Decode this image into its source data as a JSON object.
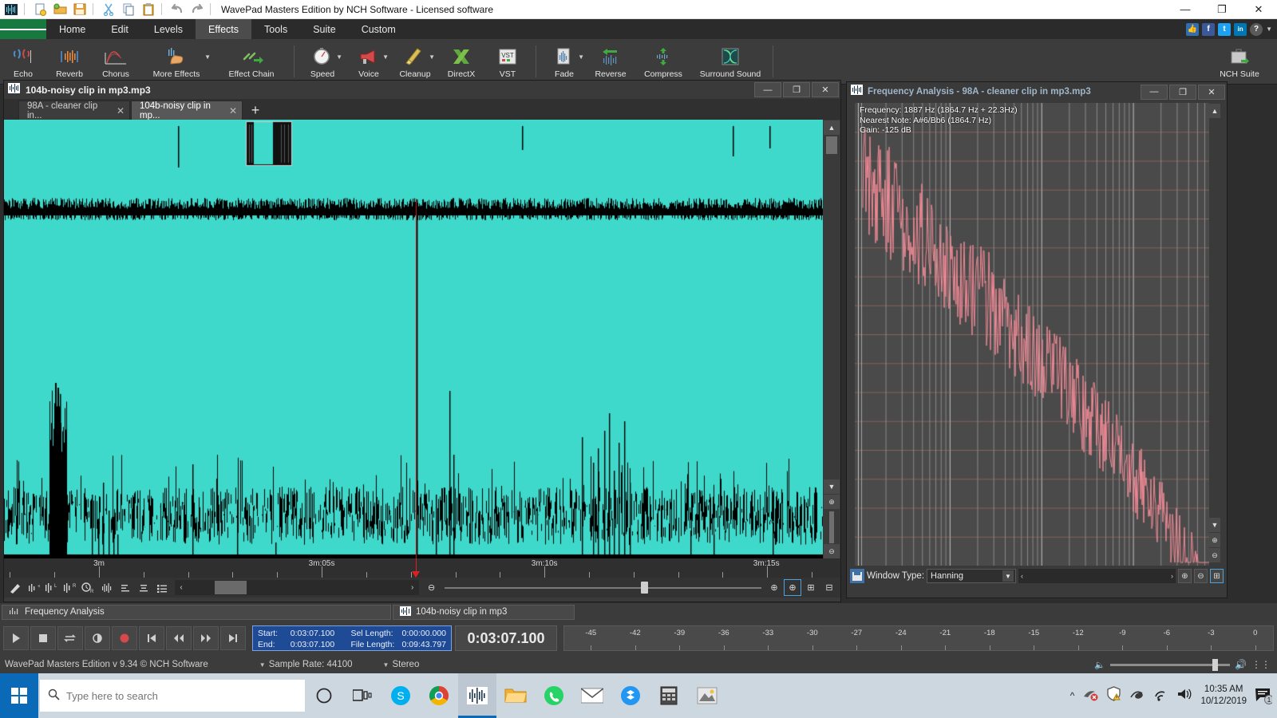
{
  "titlebar": {
    "app_icon": "waveform-icon",
    "title": "WavePad Masters Edition by NCH Software - Licensed software",
    "quick_actions": [
      {
        "name": "new-file-icon",
        "glyph": "📄"
      },
      {
        "name": "open-folder-icon",
        "glyph": "📂"
      },
      {
        "name": "save-icon",
        "glyph": "💾"
      },
      {
        "name": "cut-icon",
        "glyph": "✂"
      },
      {
        "name": "copy-icon",
        "glyph": "⧉"
      },
      {
        "name": "paste-icon",
        "glyph": "📋"
      },
      {
        "name": "undo-icon",
        "glyph": "↶"
      },
      {
        "name": "redo-icon",
        "glyph": "↷"
      }
    ],
    "minimize": "—",
    "maximize": "❐",
    "close": "✕"
  },
  "ribbon": {
    "menu_button": "hamburger-menu",
    "tabs": [
      {
        "label": "Home",
        "active": false
      },
      {
        "label": "Edit",
        "active": false
      },
      {
        "label": "Levels",
        "active": false
      },
      {
        "label": "Effects",
        "active": true
      },
      {
        "label": "Tools",
        "active": false
      },
      {
        "label": "Suite",
        "active": false
      },
      {
        "label": "Custom",
        "active": false
      }
    ],
    "social": [
      {
        "name": "thumbs-up-icon",
        "glyph": "👍",
        "color": "#2f6fb0"
      },
      {
        "name": "facebook-icon",
        "glyph": "f",
        "color": "#3b5998"
      },
      {
        "name": "twitter-icon",
        "glyph": "t",
        "color": "#1da1f2"
      },
      {
        "name": "linkedin-icon",
        "glyph": "in",
        "color": "#0077b5"
      },
      {
        "name": "help-icon",
        "glyph": "?",
        "color": "#4a4a4a"
      }
    ],
    "buttons": [
      {
        "label": "Echo",
        "icon": "echo-icon",
        "caret": false
      },
      {
        "label": "Reverb",
        "icon": "reverb-icon",
        "caret": false
      },
      {
        "label": "Chorus",
        "icon": "chorus-icon",
        "caret": false
      },
      {
        "label": "More Effects",
        "icon": "more-effects-icon",
        "caret": true
      },
      {
        "label": "Effect Chain",
        "icon": "effect-chain-icon",
        "caret": false
      },
      {
        "label": "Speed",
        "icon": "speed-icon",
        "caret": true
      },
      {
        "label": "Voice",
        "icon": "voice-icon",
        "caret": true
      },
      {
        "label": "Cleanup",
        "icon": "cleanup-icon",
        "caret": true
      },
      {
        "label": "DirectX",
        "icon": "directx-icon",
        "caret": false
      },
      {
        "label": "VST",
        "icon": "vst-icon",
        "caret": false
      },
      {
        "label": "Fade",
        "icon": "fade-icon",
        "caret": true
      },
      {
        "label": "Reverse",
        "icon": "reverse-icon",
        "caret": false
      },
      {
        "label": "Compress",
        "icon": "compress-icon",
        "caret": false
      },
      {
        "label": "Surround Sound",
        "icon": "surround-sound-icon",
        "caret": false
      }
    ],
    "suite_button": {
      "label": "NCH Suite",
      "icon": "nch-suite-icon"
    }
  },
  "document_window": {
    "title": "104b-noisy clip in mp3.mp3",
    "minimize": "—",
    "maximize": "❐",
    "close": "✕",
    "tabs": [
      {
        "label": "98A - cleaner clip in...",
        "active": false,
        "close": "✕"
      },
      {
        "label": "104b-noisy clip in mp...",
        "active": true,
        "close": "✕"
      }
    ],
    "add_tab": "+",
    "ruler_labels": [
      "3m",
      "3m:05s",
      "3m:10s",
      "3m:15s"
    ],
    "ruler_positions_pct": [
      11.6,
      38.8,
      66.0,
      93.1
    ],
    "playhead_pct": 50.3,
    "waveform_color": "#3fd9cb",
    "selection_marker_pct": 32.6,
    "tools": [
      {
        "name": "pencil-tool-icon",
        "glyph": "╱"
      },
      {
        "name": "normalize-icon",
        "glyph": "‖"
      },
      {
        "name": "left-channel-icon",
        "glyph": "‖"
      },
      {
        "name": "right-channel-icon",
        "glyph": "‖"
      },
      {
        "name": "time-shift-icon",
        "glyph": "◔"
      },
      {
        "name": "spectral-icon",
        "glyph": "‖"
      },
      {
        "name": "align-left-icon",
        "glyph": "≡"
      },
      {
        "name": "align-center-icon",
        "glyph": "≡"
      },
      {
        "name": "list-view-icon",
        "glyph": "≣"
      }
    ],
    "hscroll_left": "‹",
    "hscroll_right": "›",
    "zoom_out": "⊖",
    "zoom_in": "⊕",
    "zoom_sel": "⊕",
    "zoom_all": "⊞",
    "zoom_vert": "⊟",
    "zoom_v_in": "⊕",
    "zoom_v_out": "⊖"
  },
  "frequency_window": {
    "title": "Frequency Analysis - 98A - cleaner clip in mp3.mp3",
    "minimize": "—",
    "maximize": "❐",
    "close": "✕",
    "readout": [
      "Frequency: 1887 Hz (1864.7 Hz + 22.3Hz)",
      "Nearest Note: A#6/Bb6 (1864.7 Hz)",
      "Gain: -125 dB"
    ],
    "window_type_label": "Window Type:",
    "window_type_value": "Hanning",
    "scroll_left": "‹",
    "scroll_right": "›",
    "zoom_buttons": [
      "⊕",
      "⊖",
      "⊕",
      "⊞"
    ],
    "spectrum_color": "#f08a96"
  },
  "window_strip": [
    {
      "label": "Frequency Analysis",
      "icon": "frequency-analysis-icon"
    },
    {
      "label": "104b-noisy clip in mp3",
      "icon": "waveform-icon"
    }
  ],
  "transport": {
    "buttons": [
      {
        "name": "play-button",
        "glyph": "▶"
      },
      {
        "name": "stop-button",
        "glyph": "■"
      },
      {
        "name": "loop-button",
        "glyph": "⇄"
      },
      {
        "name": "scrub-button",
        "glyph": "◑"
      },
      {
        "name": "record-button",
        "glyph": "●"
      },
      {
        "name": "go-to-start-button",
        "glyph": "⏮"
      },
      {
        "name": "rewind-button",
        "glyph": "◀◀"
      },
      {
        "name": "fast-forward-button",
        "glyph": "▶▶"
      },
      {
        "name": "go-to-end-button",
        "glyph": "⏭"
      }
    ],
    "info": {
      "start_label": "Start:",
      "start_value": "0:03:07.100",
      "sel_length_label": "Sel Length:",
      "sel_length_value": "0:00:00.000",
      "end_label": "End:",
      "end_value": "0:03:07.100",
      "file_length_label": "File Length:",
      "file_length_value": "0:09:43.797"
    },
    "big_time": "0:03:07.100",
    "db_scale": [
      "-45",
      "-42",
      "-39",
      "-36",
      "-33",
      "-30",
      "-27",
      "-24",
      "-21",
      "-18",
      "-15",
      "-12",
      "-9",
      "-6",
      "-3",
      "0"
    ]
  },
  "statusbar": {
    "version": "WavePad Masters Edition v 9.34 © NCH Software",
    "sample_rate": "Sample Rate: 44100",
    "channels": "Stereo",
    "volume_icon_left": "🔈",
    "volume_icon_right": "🔊",
    "settings_icon": "⚙"
  },
  "taskbar": {
    "start": "start-button",
    "search_placeholder": "Type here to search",
    "search_icon": "search-icon",
    "apps": [
      {
        "name": "cortana-icon",
        "glyph": "○",
        "color": "#2b2b2b",
        "active": false
      },
      {
        "name": "task-view-icon",
        "glyph": "⌸",
        "color": "#2b2b2b",
        "active": false
      },
      {
        "name": "skype-icon",
        "glyph": "S",
        "color": "#00aff0",
        "active": false
      },
      {
        "name": "chrome-icon",
        "glyph": "●",
        "color": "#4285f4",
        "active": false
      },
      {
        "name": "wavepad-icon",
        "glyph": "‖",
        "color": "#3a4a55",
        "active": true
      },
      {
        "name": "file-explorer-icon",
        "glyph": "📁",
        "color": "#f2b134",
        "active": false
      },
      {
        "name": "whatsapp-icon",
        "glyph": "☎",
        "color": "#25d366",
        "active": false
      },
      {
        "name": "mail-icon",
        "glyph": "✉",
        "color": "#ffffff",
        "active": false
      },
      {
        "name": "dropbox-icon",
        "glyph": "◆",
        "color": "#0061ff",
        "active": false
      },
      {
        "name": "calculator-icon",
        "glyph": "⊞",
        "color": "#555555",
        "active": false
      },
      {
        "name": "photos-icon",
        "glyph": "⛰",
        "color": "#777777",
        "active": false
      }
    ],
    "tray": [
      {
        "name": "show-hidden-icons",
        "glyph": "˄"
      },
      {
        "name": "nvidia-icon",
        "glyph": "➤"
      },
      {
        "name": "security-warning-icon",
        "glyph": "⛨"
      },
      {
        "name": "bluetooth-icon",
        "glyph": "⎋"
      },
      {
        "name": "wifi-icon",
        "glyph": "◠"
      },
      {
        "name": "volume-icon",
        "glyph": "🔊"
      }
    ],
    "time": "10:35 AM",
    "date": "10/12/2019",
    "notification_count": "1"
  }
}
